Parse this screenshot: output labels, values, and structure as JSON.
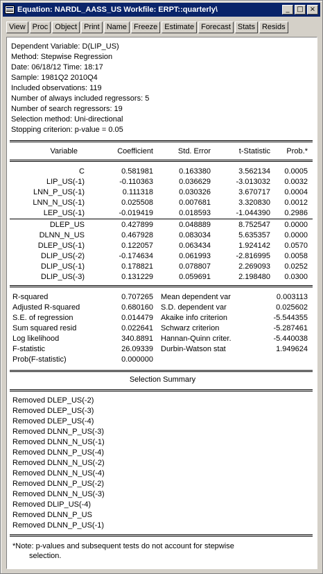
{
  "window": {
    "title": "Equation: NARDL_AASS_US   Workfile: ERPT::quarterly\\",
    "controls": [
      "_",
      "□",
      "×"
    ]
  },
  "toolbar": {
    "buttons": [
      "View",
      "Proc",
      "Object",
      "Print",
      "Name",
      "Freeze",
      "Estimate",
      "Forecast",
      "Stats",
      "Resids"
    ]
  },
  "header": {
    "lines": [
      "Dependent Variable: D(LIP_US)",
      "Method: Stepwise Regression",
      "Date: 06/18/12   Time: 18:17",
      "Sample: 1981Q2 2010Q4",
      "Included observations: 119",
      "Number of always included regressors: 5",
      "Number of search regressors: 19",
      "Selection method: Uni-directional",
      "Stopping criterion: p-value  = 0.05"
    ]
  },
  "coef_table": {
    "columns": [
      "Variable",
      "Coefficient",
      "Std. Error",
      "t-Statistic",
      "Prob.*"
    ],
    "always_rows": [
      [
        "C",
        "0.581981",
        "0.163380",
        "3.562134",
        "0.0005"
      ],
      [
        "LIP_US(-1)",
        "-0.110363",
        "0.036629",
        "-3.013032",
        "0.0032"
      ],
      [
        "LNN_P_US(-1)",
        "0.111318",
        "0.030326",
        "3.670717",
        "0.0004"
      ],
      [
        "LNN_N_US(-1)",
        "0.025508",
        "0.007681",
        "3.320830",
        "0.0012"
      ],
      [
        "LEP_US(-1)",
        "-0.019419",
        "0.018593",
        "-1.044390",
        "0.2986"
      ]
    ],
    "search_rows": [
      [
        "DLEP_US",
        "0.427899",
        "0.048889",
        "8.752547",
        "0.0000"
      ],
      [
        "DLNN_N_US",
        "0.467928",
        "0.083034",
        "5.635357",
        "0.0000"
      ],
      [
        "DLEP_US(-1)",
        "0.122057",
        "0.063434",
        "1.924142",
        "0.0570"
      ],
      [
        "DLIP_US(-2)",
        "-0.174634",
        "0.061993",
        "-2.816995",
        "0.0058"
      ],
      [
        "DLIP_US(-1)",
        "0.178821",
        "0.078807",
        "2.269093",
        "0.0252"
      ],
      [
        "DLIP_US(-3)",
        "0.131229",
        "0.059691",
        "2.198480",
        "0.0300"
      ]
    ]
  },
  "stats": [
    [
      "R-squared",
      "0.707265",
      "Mean dependent var",
      "0.003113"
    ],
    [
      "Adjusted R-squared",
      "0.680160",
      "S.D. dependent var",
      "0.025602"
    ],
    [
      "S.E. of regression",
      "0.014479",
      "Akaike info criterion",
      "-5.544355"
    ],
    [
      "Sum squared resid",
      "0.022641",
      "Schwarz criterion",
      "-5.287461"
    ],
    [
      "Log likelihood",
      "340.8891",
      "Hannan-Quinn criter.",
      "-5.440038"
    ],
    [
      "F-statistic",
      "26.09339",
      "Durbin-Watson stat",
      "1.949624"
    ],
    [
      "Prob(F-statistic)",
      "0.000000",
      "",
      ""
    ]
  ],
  "selection_summary": {
    "title": "Selection Summary",
    "items": [
      "Removed DLEP_US(-2)",
      "Removed DLEP_US(-3)",
      "Removed DLEP_US(-4)",
      "Removed DLNN_P_US(-3)",
      "Removed DLNN_N_US(-1)",
      "Removed DLNN_P_US(-4)",
      "Removed DLNN_N_US(-2)",
      "Removed DLNN_N_US(-4)",
      "Removed DLNN_P_US(-2)",
      "Removed DLNN_N_US(-3)",
      "Removed DLIP_US(-4)",
      "Removed DLNN_P_US",
      "Removed DLNN_P_US(-1)"
    ]
  },
  "note": {
    "line1": "*Note: p-values and subsequent tests do not account for stepwise",
    "line2": "selection."
  }
}
